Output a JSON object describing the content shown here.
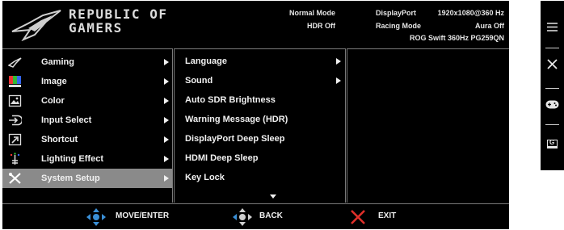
{
  "header": {
    "brand_line1": "REPUBLIC OF",
    "brand_line2": "GAMERS",
    "mode": "Normal Mode",
    "hdr": "HDR Off",
    "port": "DisplayPort",
    "resolution": "1920x1080@360 Hz",
    "racing": "Racing Mode",
    "aura": "Aura Off",
    "model": "ROG Swift 360Hz PG259QN"
  },
  "main_menu": [
    {
      "label": "Gaming",
      "icon": "rog-eye-icon"
    },
    {
      "label": "Image",
      "icon": "image-palette-icon"
    },
    {
      "label": "Color",
      "icon": "picture-icon"
    },
    {
      "label": "Input Select",
      "icon": "input-select-icon"
    },
    {
      "label": "Shortcut",
      "icon": "shortcut-icon"
    },
    {
      "label": "Lighting Effect",
      "icon": "lighting-bulb-icon"
    },
    {
      "label": "System Setup",
      "icon": "tools-icon",
      "selected": true
    }
  ],
  "submenu": [
    {
      "label": "Language",
      "has_arrow": true
    },
    {
      "label": "Sound",
      "has_arrow": true
    },
    {
      "label": "Auto SDR Brightness",
      "has_arrow": false
    },
    {
      "label": "Warning Message (HDR)",
      "has_arrow": false
    },
    {
      "label": "DisplayPort Deep Sleep",
      "has_arrow": false
    },
    {
      "label": "HDMI Deep Sleep",
      "has_arrow": false
    },
    {
      "label": "Key Lock",
      "has_arrow": false
    }
  ],
  "footer": {
    "move_enter": "MOVE/ENTER",
    "back": "BACK",
    "exit": "EXIT"
  },
  "side_panel": [
    "menu-icon",
    "close-icon",
    "gamepad-icon",
    "gameplus-icon"
  ],
  "side_gameplus_letter": "G",
  "colors": {
    "selected_row": "#8a8a8a",
    "dpad_blue": "#3a8fd6",
    "exit_red": "#e0302a"
  }
}
